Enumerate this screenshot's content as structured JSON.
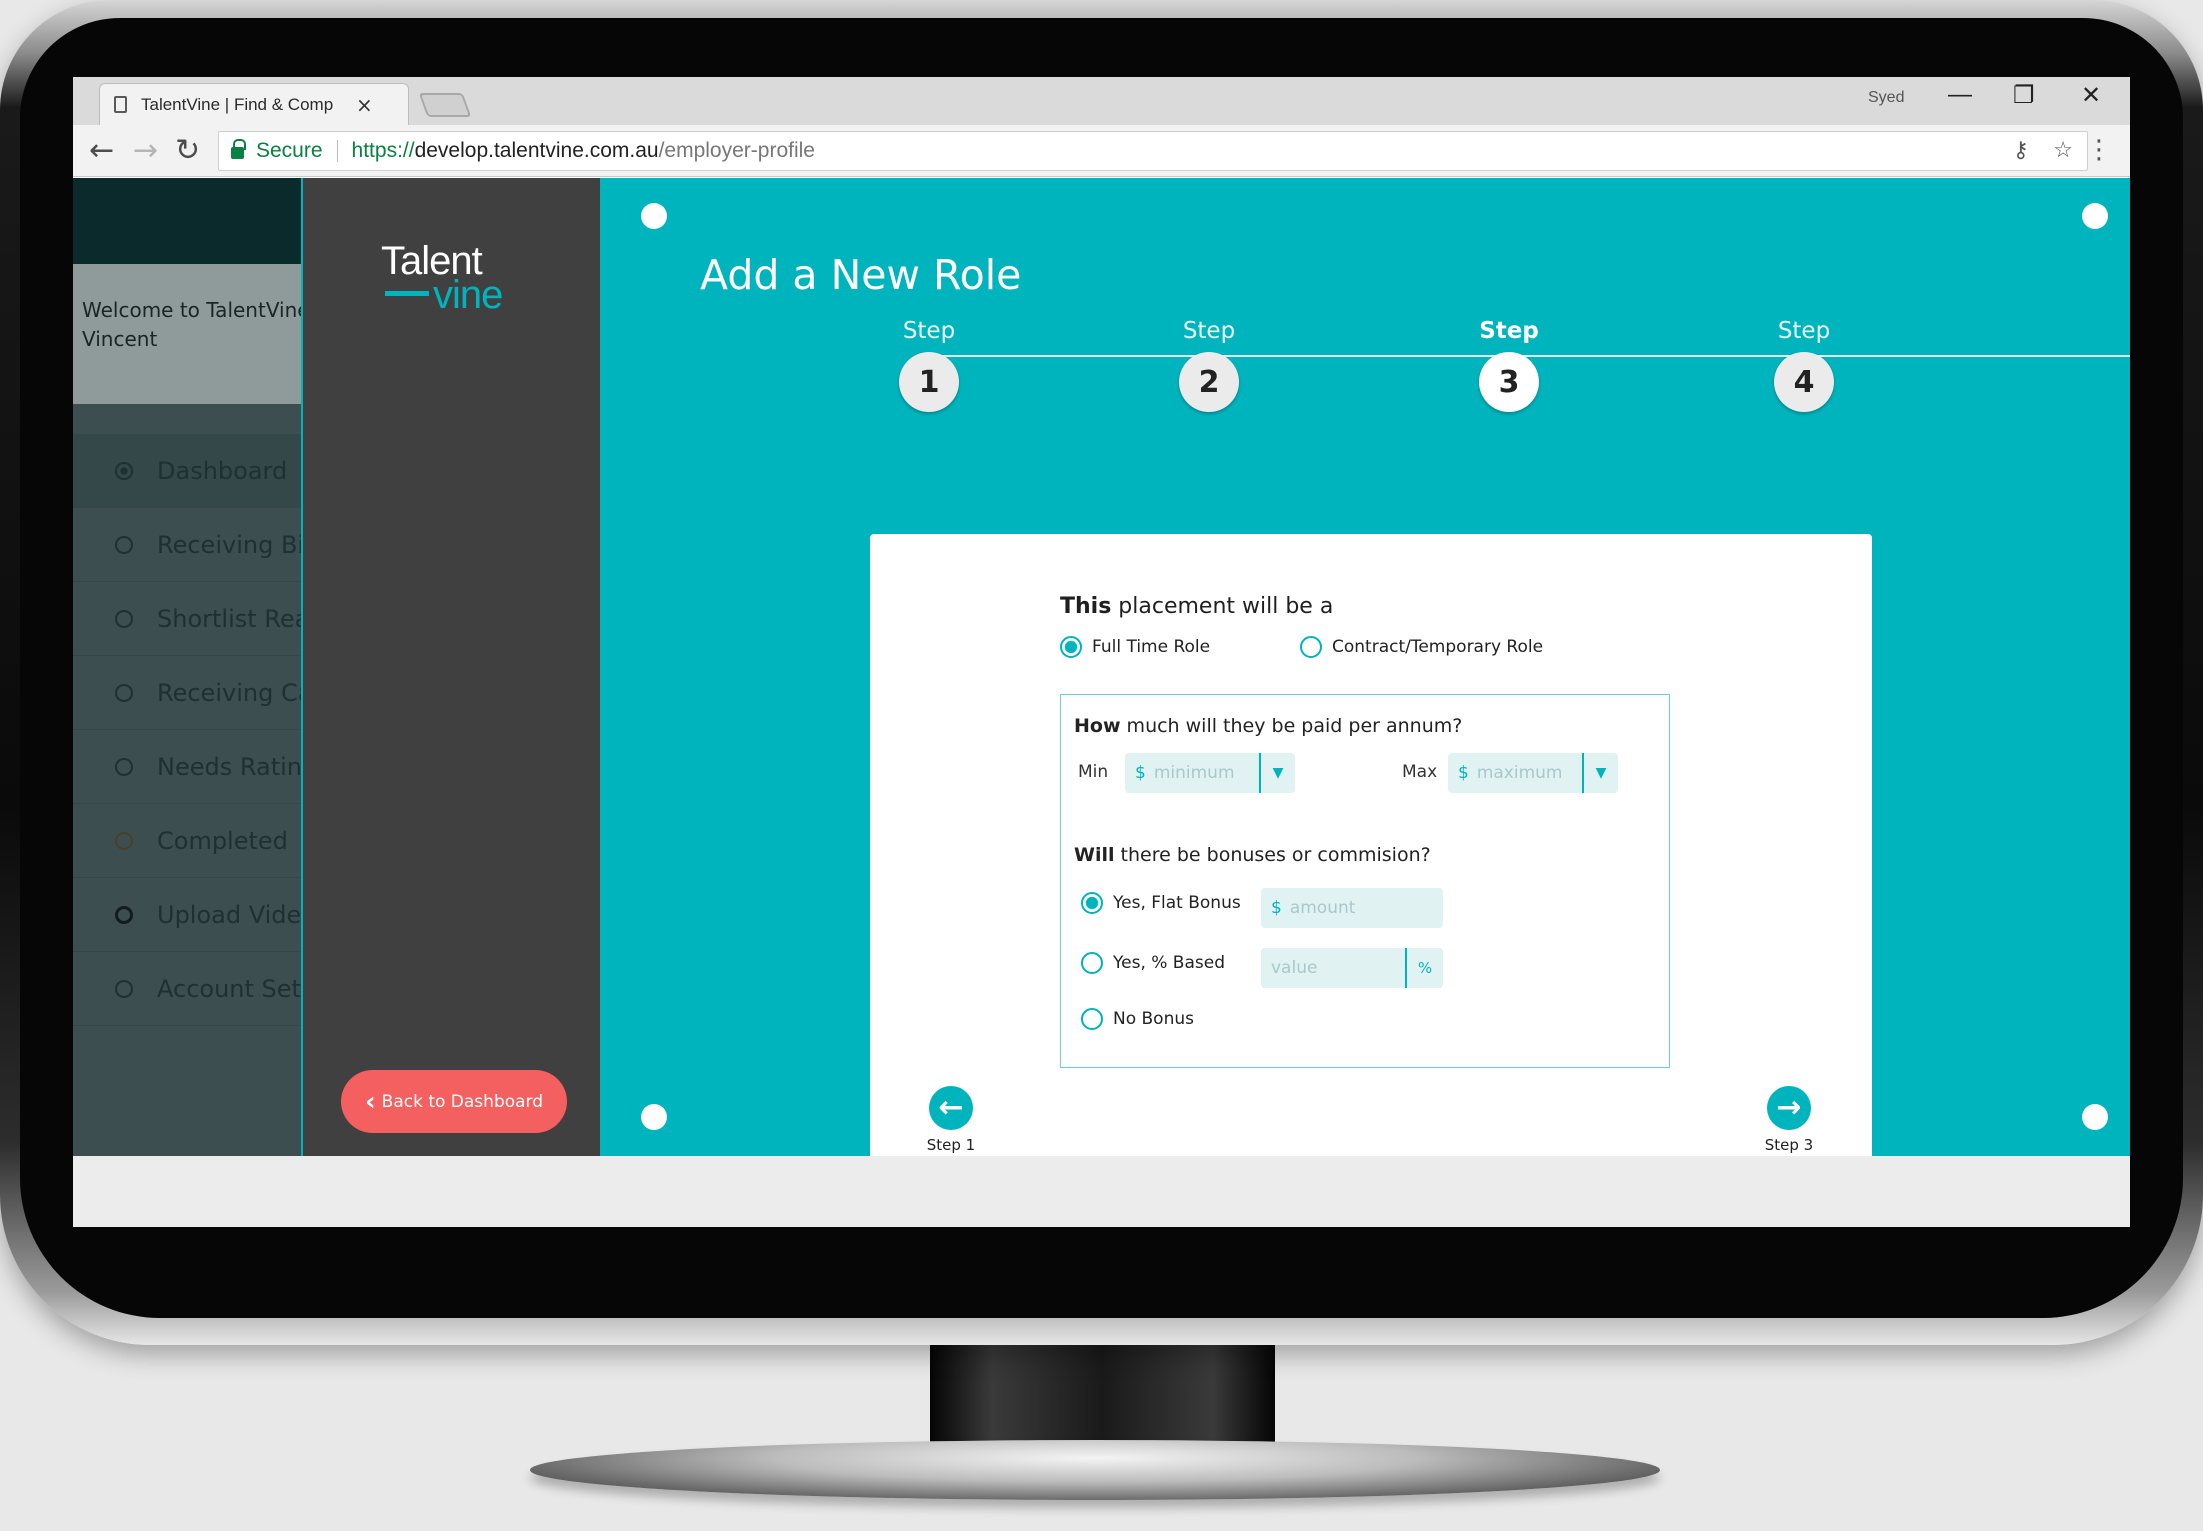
{
  "browser": {
    "tab_title": "TalentVine | Find & Comp",
    "tab_close": "×",
    "user": "Syed",
    "minimize": "—",
    "restore": "❐",
    "close": "✕",
    "back": "←",
    "forward": "→",
    "reload": "↻",
    "secure_label": "Secure",
    "url_scheme": "https://",
    "url_host": "develop.talentvine.com.au",
    "url_path": "/employer-profile",
    "key_icon": "⚷",
    "star_icon": "☆",
    "menu_icon": "⋮"
  },
  "dashboard": {
    "welcome_line1": "Welcome to TalentVine",
    "welcome_line2": "Vincent",
    "items": [
      {
        "label": "Dashboard"
      },
      {
        "label": "Receiving Bids"
      },
      {
        "label": "Shortlist Ready"
      },
      {
        "label": "Receiving Candidates"
      },
      {
        "label": "Needs Rating"
      },
      {
        "label": "Completed"
      },
      {
        "label": "Upload Video"
      },
      {
        "label": "Account Settings"
      }
    ]
  },
  "logo": {
    "line1": "Talent",
    "line2": "vine"
  },
  "back_button": {
    "icon": "‹",
    "label": "Back to Dashboard"
  },
  "main": {
    "title": "Add a New Role",
    "steps": [
      {
        "label": "Step",
        "number": "1"
      },
      {
        "label": "Step",
        "number": "2"
      },
      {
        "label": "Step",
        "number": "3"
      },
      {
        "label": "Step",
        "number": "4"
      }
    ],
    "current_step": 3,
    "placement": {
      "question_bold": "This",
      "question_rest": " placement will be a",
      "options": [
        "Full Time Role",
        "Contract/Temporary Role"
      ],
      "selected": "Full Time Role"
    },
    "salary": {
      "question_bold": "How",
      "question_rest": " much will they be paid per annum?",
      "min_label": "Min",
      "min_placeholder": "minimum",
      "max_label": "Max",
      "max_placeholder": "maximum",
      "currency": "$",
      "caret": "▼"
    },
    "bonus": {
      "question_bold": "Will",
      "question_rest": " there be bonuses or commision?",
      "options": [
        "Yes, Flat Bonus",
        "Yes, % Based",
        "No Bonus"
      ],
      "selected": "Yes, Flat Bonus",
      "amount_placeholder": "amount",
      "value_placeholder": "value",
      "percent_symbol": "%",
      "currency": "$"
    },
    "prev": {
      "icon": "←",
      "label": "Step 1"
    },
    "next": {
      "icon": "→",
      "label": "Step 3"
    }
  },
  "colors": {
    "accent": "#00b4bd",
    "back_button": "#f45f5f",
    "logo_panel": "#404040"
  }
}
